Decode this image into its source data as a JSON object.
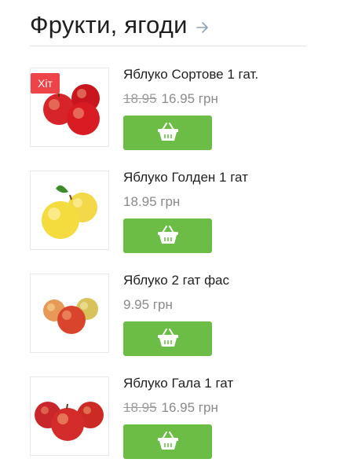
{
  "section": {
    "title": "Фрукти, ягоди"
  },
  "colors": {
    "accent": "#6cbd45",
    "badge": "#ee4449"
  },
  "products": [
    {
      "name": "Яблуко Сортове 1 гат.",
      "old_price": "18.95",
      "price": "16.95 грн",
      "badge": "Хіт",
      "image": "red-apples"
    },
    {
      "name": "Яблуко Голден 1 гат",
      "old_price": "",
      "price": "18.95 грн",
      "badge": "",
      "image": "golden-apples"
    },
    {
      "name": "Яблуко 2 гат фас",
      "old_price": "",
      "price": "9.95 грн",
      "badge": "",
      "image": "mixed-apples"
    },
    {
      "name": "Яблуко Гала 1 гат",
      "old_price": "18.95",
      "price": "16.95 грн",
      "badge": "",
      "image": "gala-apples"
    }
  ]
}
